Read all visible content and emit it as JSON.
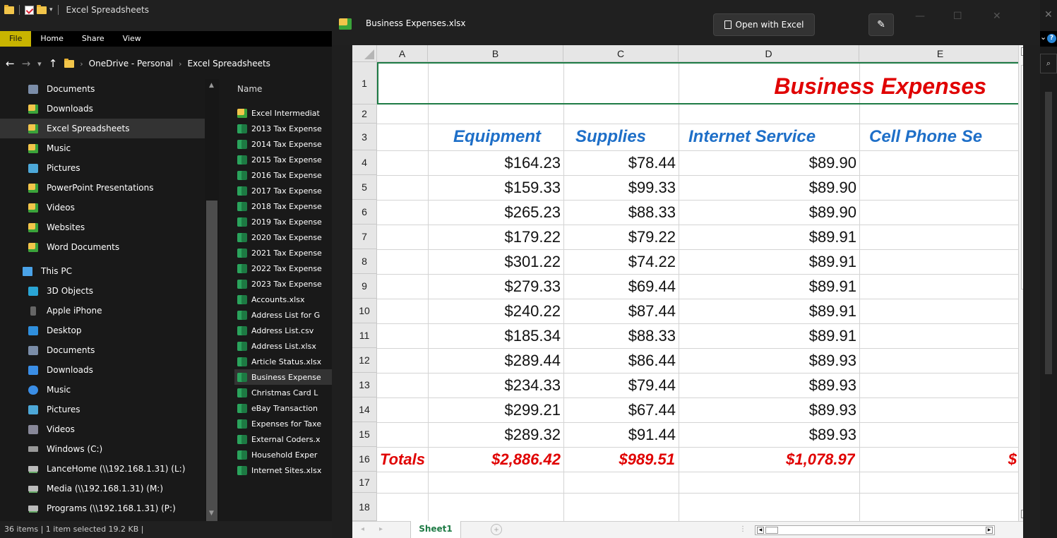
{
  "explorer": {
    "title": "Excel Spreadsheets",
    "ribbon_tabs": [
      "File",
      "Home",
      "Share",
      "View"
    ],
    "breadcrumb": [
      "OneDrive - Personal",
      "Excel Spreadsheets"
    ],
    "nav_items": [
      {
        "label": "Documents",
        "icon": "documents-icon"
      },
      {
        "label": "Downloads",
        "icon": "folder-icon"
      },
      {
        "label": "Excel Spreadsheets",
        "icon": "folder-icon",
        "selected": true
      },
      {
        "label": "Music",
        "icon": "folder-icon"
      },
      {
        "label": "Pictures",
        "icon": "pictures-icon"
      },
      {
        "label": "PowerPoint Presentations",
        "icon": "folder-icon"
      },
      {
        "label": "Videos",
        "icon": "folder-icon"
      },
      {
        "label": "Websites",
        "icon": "folder-icon"
      },
      {
        "label": "Word Documents",
        "icon": "folder-icon"
      }
    ],
    "this_pc": "This PC",
    "pc_items": [
      {
        "label": "3D Objects",
        "icon": "3d-objects-icon"
      },
      {
        "label": "Apple iPhone",
        "icon": "phone-icon"
      },
      {
        "label": "Desktop",
        "icon": "desktop-icon"
      },
      {
        "label": "Documents",
        "icon": "documents-icon"
      },
      {
        "label": "Downloads",
        "icon": "downloads-icon"
      },
      {
        "label": "Music",
        "icon": "music-icon"
      },
      {
        "label": "Pictures",
        "icon": "pictures-icon"
      },
      {
        "label": "Videos",
        "icon": "videos-icon"
      },
      {
        "label": "Windows (C:)",
        "icon": "drive-icon"
      },
      {
        "label": "LanceHome (\\\\192.168.1.31) (L:)",
        "icon": "network-drive-icon"
      },
      {
        "label": "Media (\\\\192.168.1.31) (M:)",
        "icon": "network-drive-icon"
      },
      {
        "label": "Programs (\\\\192.168.1.31) (P:)",
        "icon": "network-drive-icon"
      }
    ],
    "files_header": "Name",
    "files": [
      {
        "name": "Excel Intermediat",
        "type": "folder"
      },
      {
        "name": "2013 Tax Expense",
        "type": "xlsx"
      },
      {
        "name": "2014 Tax Expense",
        "type": "xlsx"
      },
      {
        "name": "2015 Tax Expense",
        "type": "xlsx"
      },
      {
        "name": "2016 Tax Expense",
        "type": "xlsx"
      },
      {
        "name": "2017 Tax Expense",
        "type": "xlsx"
      },
      {
        "name": "2018 Tax Expense",
        "type": "xlsx"
      },
      {
        "name": "2019 Tax Expense",
        "type": "xlsx"
      },
      {
        "name": "2020 Tax Expense",
        "type": "xlsx"
      },
      {
        "name": "2021 Tax Expense",
        "type": "xlsx"
      },
      {
        "name": "2022 Tax Expense",
        "type": "xlsx"
      },
      {
        "name": "2023 Tax Expense",
        "type": "xlsx"
      },
      {
        "name": "Accounts.xlsx",
        "type": "xlsx"
      },
      {
        "name": "Address List for G",
        "type": "xlsx"
      },
      {
        "name": "Address List.csv",
        "type": "xlsx"
      },
      {
        "name": "Address List.xlsx",
        "type": "xlsx"
      },
      {
        "name": "Article Status.xlsx",
        "type": "xlsx"
      },
      {
        "name": "Business Expense",
        "type": "xlsx",
        "selected": true
      },
      {
        "name": "Christmas Card L",
        "type": "xlsx"
      },
      {
        "name": "eBay Transaction",
        "type": "xlsx"
      },
      {
        "name": "Expenses for Taxe",
        "type": "xlsx"
      },
      {
        "name": "External Coders.x",
        "type": "xlsx"
      },
      {
        "name": "Household Exper",
        "type": "xlsx"
      },
      {
        "name": "Internet Sites.xlsx",
        "type": "xlsx"
      }
    ],
    "status": "36 items  |  1 item selected  19.2 KB  |"
  },
  "preview": {
    "filename": "Business Expenses.xlsx",
    "open_button": "Open with Excel",
    "window_controls": [
      "—",
      "☐",
      "✕"
    ]
  },
  "sheet": {
    "columns": [
      "A",
      "B",
      "C",
      "D",
      "E"
    ],
    "rows": [
      "1",
      "2",
      "3",
      "4",
      "5",
      "6",
      "7",
      "8",
      "9",
      "10",
      "11",
      "12",
      "13",
      "14",
      "15",
      "16",
      "17",
      "18"
    ],
    "title": "Business Expenses",
    "headers": [
      "Equipment",
      "Supplies",
      "Internet Service",
      "Cell Phone Se"
    ],
    "data": [
      [
        "$164.23",
        "$78.44",
        "$89.90"
      ],
      [
        "$159.33",
        "$99.33",
        "$89.90"
      ],
      [
        "$265.23",
        "$88.33",
        "$89.90"
      ],
      [
        "$179.22",
        "$79.22",
        "$89.91"
      ],
      [
        "$301.22",
        "$74.22",
        "$89.91"
      ],
      [
        "$279.33",
        "$69.44",
        "$89.91"
      ],
      [
        "$240.22",
        "$87.44",
        "$89.91"
      ],
      [
        "$185.34",
        "$88.33",
        "$89.91"
      ],
      [
        "$289.44",
        "$86.44",
        "$89.93"
      ],
      [
        "$234.33",
        "$79.44",
        "$89.93"
      ],
      [
        "$299.21",
        "$67.44",
        "$89.93"
      ],
      [
        "$289.32",
        "$91.44",
        "$89.93"
      ]
    ],
    "totals_label": "Totals",
    "totals": [
      "$2,886.42",
      "$989.51",
      "$1,078.97",
      "$"
    ],
    "tab_name": "Sheet1"
  },
  "colors": {
    "title_red": "#e00000",
    "header_blue": "#1e6fc8",
    "excel_green": "#1e7b45",
    "ribbon_file": "#c8b400"
  }
}
